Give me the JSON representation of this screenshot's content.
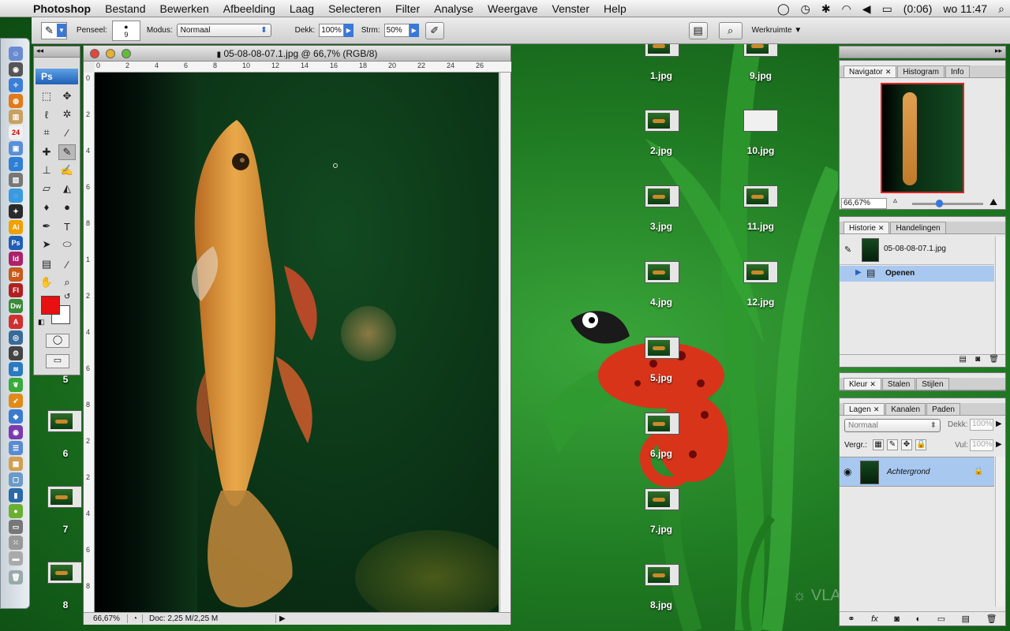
{
  "menubar": {
    "apple": "",
    "app": "Photoshop",
    "items": [
      "Bestand",
      "Bewerken",
      "Afbeelding",
      "Laag",
      "Selecteren",
      "Filter",
      "Analyse",
      "Weergave",
      "Venster",
      "Help"
    ],
    "battery": "(0:06)",
    "clock": "wo 11:47"
  },
  "options": {
    "brush_label": "Penseel:",
    "brush_size": "9",
    "mode_label": "Modus:",
    "mode_value": "Normaal",
    "opacity_label": "Dekk:",
    "opacity_value": "100%",
    "flow_label": "Strm:",
    "flow_value": "50%",
    "workspace_label": "Werkruimte"
  },
  "toolbox": {
    "logo": "Ps",
    "foreground_color": "#e81010",
    "background_color": "#ffffff"
  },
  "document": {
    "title": "05-08-08-07.1.jpg @ 66,7% (RGB/8)",
    "ruler_h": [
      "0",
      "2",
      "4",
      "6",
      "8",
      "10",
      "12",
      "14",
      "16",
      "18",
      "20",
      "22",
      "24",
      "26"
    ],
    "ruler_v": [
      "0",
      "2",
      "4",
      "6",
      "8",
      "1",
      "2",
      "4",
      "6",
      "8",
      "2",
      "2",
      "4",
      "6",
      "8"
    ],
    "zoom": "66,67%",
    "doc_info": "Doc: 2,25 M/2,25 M"
  },
  "desktop": {
    "icons": [
      "1.jpg",
      "2.jpg",
      "3.jpg",
      "4.jpg",
      "5.jpg",
      "6.jpg",
      "7.jpg",
      "8.jpg",
      "9.jpg",
      "10.jpg",
      "11.jpg",
      "12.jpg"
    ],
    "side_labels": [
      "5",
      "6",
      "7",
      "8"
    ],
    "watermark": "VLAD"
  },
  "navigator": {
    "tabs": [
      "Navigator",
      "Histogram",
      "Info"
    ],
    "zoom": "66,67%"
  },
  "history": {
    "tabs": [
      "Historie",
      "Handelingen"
    ],
    "snapshot": "05-08-08-07.1.jpg",
    "step": "Openen"
  },
  "color_panel": {
    "tabs": [
      "Kleur",
      "Stalen",
      "Stijlen"
    ]
  },
  "layers": {
    "tabs": [
      "Lagen",
      "Kanalen",
      "Paden"
    ],
    "blend_mode": "Normaal",
    "opacity_label": "Dekk:",
    "opacity_value": "100%",
    "lock_label": "Vergr.:",
    "fill_label": "Vul:",
    "fill_value": "100%",
    "layer_name": "Achtergrond"
  }
}
